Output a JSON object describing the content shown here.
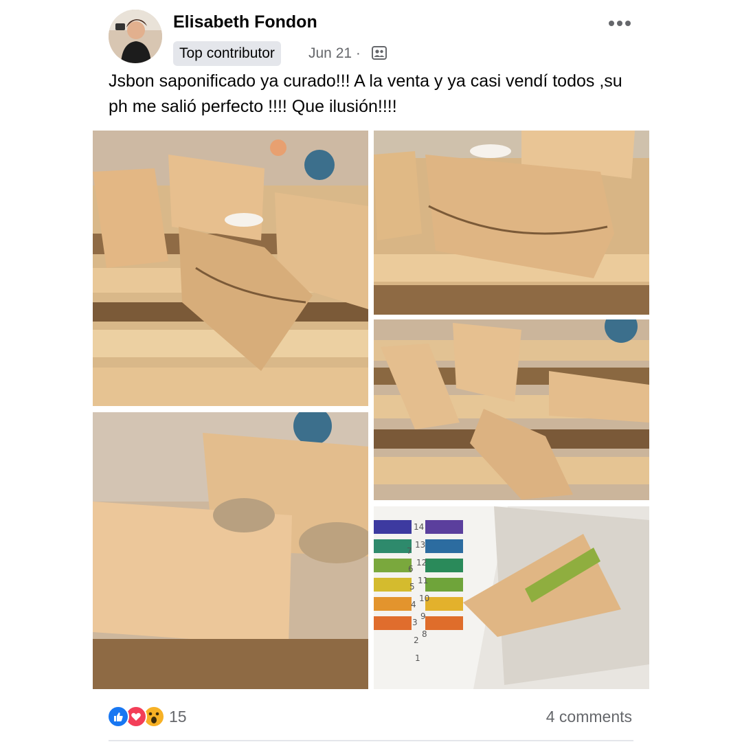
{
  "post": {
    "author": "Elisabeth Fondon",
    "badge": "Top contributor",
    "date": "Jun 21 ·",
    "audience_icon": "friends-icon",
    "text": "Jsbon saponificado ya curado!!! A la venta y ya casi vendí todos ,su ph me salió perfecto !!!! Que ilusión!!!!"
  },
  "photos": [
    {
      "name": "photo-soap-bars-on-rack",
      "icon": "photo"
    },
    {
      "name": "photo-wrapped-soap-closeup",
      "icon": "photo"
    },
    {
      "name": "photo-soap-bars-scattered",
      "icon": "photo"
    },
    {
      "name": "photo-soap-oat-topping",
      "icon": "photo"
    },
    {
      "name": "photo-ph-test-strip",
      "icon": "photo"
    }
  ],
  "ph_chart": {
    "scale_top": [
      "8",
      "9",
      "10",
      "11",
      "12",
      "13",
      "14"
    ],
    "scale_bottom": [
      "1",
      "2",
      "3",
      "4",
      "5",
      "6",
      "7"
    ]
  },
  "footer": {
    "reactions": [
      "like",
      "love",
      "wow"
    ],
    "reaction_count": "15",
    "comments": "4 comments"
  },
  "colors": {
    "facebook_blue": "#1877f2",
    "love_red": "#f33e58",
    "wow_yellow": "#f7b125",
    "secondary_text": "#65676b"
  }
}
